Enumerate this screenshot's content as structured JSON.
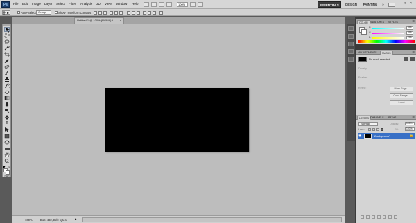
{
  "app": {
    "logo_text": "Ps"
  },
  "menu": {
    "items": [
      "File",
      "Edit",
      "Image",
      "Layer",
      "Select",
      "Filter",
      "Analysis",
      "3D",
      "View",
      "Window",
      "Help"
    ],
    "zoom": "100%"
  },
  "workspaces": {
    "essentials": "ESSENTIALS",
    "design": "DESIGN",
    "painting": "PAINTING",
    "more": "»"
  },
  "options": {
    "auto_select_label": "Auto-Select:",
    "auto_select_value": "Group",
    "show_transform_label": "Show Transform Controls"
  },
  "document": {
    "tab_title": "Untitled-1 @ 100% (RGB/8) *",
    "tab_close": "×"
  },
  "status": {
    "zoom": "100%",
    "doc_size": "Doc: 492,8K/0 bytes"
  },
  "color_panel": {
    "tabs": [
      "COLOR",
      "SWATCHES",
      "STYLES"
    ],
    "channels": [
      {
        "letter": "R",
        "value": "255"
      },
      {
        "letter": "G",
        "value": "255"
      },
      {
        "letter": "B",
        "value": "255"
      }
    ]
  },
  "adjust_panel": {
    "tabs": [
      "ADJUSTMENTS",
      "MASKS"
    ],
    "no_mask": "No mask selected",
    "density_label": "Density:",
    "feather_label": "Feather:",
    "refine_label": "Refine:",
    "btn_mask_edge": "Mask Edge...",
    "btn_color_range": "Color Range...",
    "btn_invert": "Invert"
  },
  "layers_panel": {
    "tabs": [
      "LAYERS",
      "CHANNELS",
      "PATHS"
    ],
    "blend_mode": "Normal",
    "opacity_label": "Opacity:",
    "opacity_value": "100%",
    "lock_label": "Lock:",
    "fill_label": "Fill:",
    "fill_value": "100%",
    "layers": [
      {
        "name": "Background"
      }
    ]
  },
  "colors": {
    "canvas": "#000000",
    "workspace": "#bdbdbd",
    "selected_layer": "#3870c6"
  }
}
